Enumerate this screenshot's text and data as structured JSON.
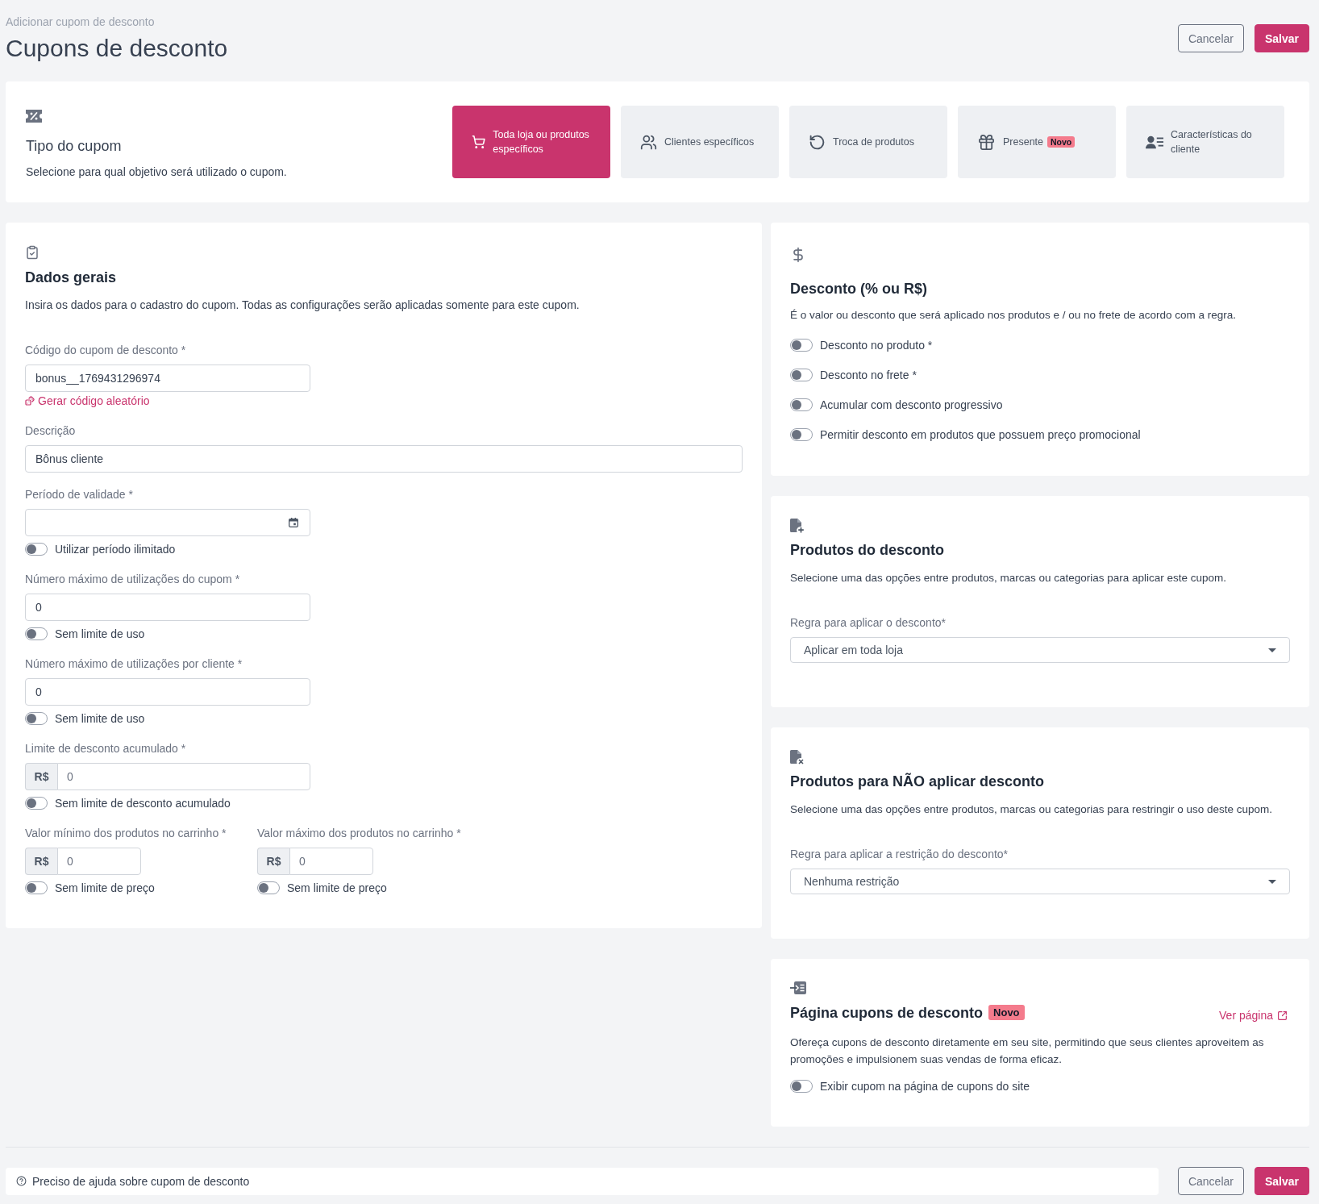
{
  "header": {
    "breadcrumb": "Adicionar cupom de desconto",
    "title": "Cupons de desconto",
    "buttons": [
      {
        "label": "Cancelar",
        "kind": "secondary"
      },
      {
        "label": "Salvar",
        "kind": "primary"
      }
    ]
  },
  "coupon_type": {
    "title": "Tipo do cupom",
    "description": "Selecione para qual objetivo será utilizado o cupom.",
    "options": [
      {
        "label": "Toda loja ou produtos específicos",
        "selected": true
      },
      {
        "label": "Clientes específicos",
        "selected": false
      },
      {
        "label": "Troca de produtos",
        "selected": false
      },
      {
        "label": "Presente",
        "badge": "Novo",
        "selected": false
      },
      {
        "label": "Características do cliente",
        "selected": false
      }
    ]
  },
  "general_data": {
    "title": "Dados gerais",
    "description": "Insira os dados para o cadastro do cupom. Todas as configurações serão aplicadas somente para este cupom.",
    "fields": [
      {
        "kind": "code",
        "label": "Código do cupom de desconto *",
        "value": "bonus__1769431296974",
        "link": "Gerar código aleatório"
      },
      {
        "kind": "text",
        "label": "Descrição",
        "value": "Bônus cliente"
      },
      {
        "kind": "date",
        "label": "Período de validade *",
        "toggle": {
          "label": "Utilizar período ilimitado",
          "on": false
        }
      },
      {
        "kind": "number",
        "label": "Número máximo de utilizações do cupom *",
        "value": "0",
        "toggle": {
          "label": "Sem limite de uso",
          "on": false
        }
      },
      {
        "kind": "number",
        "label": "Número máximo de utilizações por cliente *",
        "value": "0",
        "toggle": {
          "label": "Sem limite de uso",
          "on": false
        }
      },
      {
        "kind": "currency",
        "label": "Limite de desconto acumulado *",
        "prefix": "R$",
        "value": "0",
        "toggle": {
          "label": "Sem limite de desconto acumulado",
          "on": false
        }
      },
      {
        "kind": "pair",
        "items": [
          {
            "kind": "currency",
            "label": "Valor mínimo dos produtos no carrinho *",
            "prefix": "R$",
            "value": "0",
            "toggle": {
              "label": "Sem limite de preço",
              "on": false
            }
          },
          {
            "kind": "currency",
            "label": "Valor máximo dos produtos no carrinho *",
            "prefix": "R$",
            "value": "0",
            "toggle": {
              "label": "Sem limite de preço",
              "on": false
            }
          }
        ]
      }
    ]
  },
  "discount": {
    "title": "Desconto (% ou R$)",
    "description": "É o valor ou desconto que será aplicado nos produtos e / ou no frete de acordo com a regra.",
    "toggles": [
      {
        "label": "Desconto no produto *",
        "on": false
      },
      {
        "label": "Desconto no frete *",
        "on": false
      },
      {
        "label": "Acumular com desconto progressivo",
        "on": false
      },
      {
        "label": "Permitir desconto em produtos que possuem preço promocional",
        "on": false
      }
    ]
  },
  "discount_products": {
    "title": "Produtos do desconto",
    "description": "Selecione uma das opções entre produtos, marcas ou categorias para aplicar este cupom.",
    "rule": {
      "label": "Regra para aplicar o desconto*",
      "value": "Aplicar em toda loja"
    }
  },
  "excluded_products": {
    "title": "Produtos para NÃO aplicar desconto",
    "description": "Selecione uma das opções entre produtos, marcas ou categorias para restringir o uso deste cupom.",
    "rule": {
      "label": "Regra para aplicar a restrição do desconto*",
      "value": "Nenhuma restrição"
    }
  },
  "coupon_page": {
    "title": "Página cupons de desconto",
    "badge": "Novo",
    "link": "Ver página",
    "description": "Ofereça cupons de desconto diretamente em seu site, permitindo que seus clientes aproveitem as promoções e impulsionem suas vendas de forma eficaz.",
    "toggle": {
      "label": "Exibir cupom na página de cupons do site",
      "on": false
    }
  },
  "footer": {
    "help": "Preciso de ajuda sobre cupom de desconto",
    "buttons": [
      {
        "label": "Cancelar",
        "kind": "secondary"
      },
      {
        "label": "Salvar",
        "kind": "primary"
      }
    ]
  }
}
